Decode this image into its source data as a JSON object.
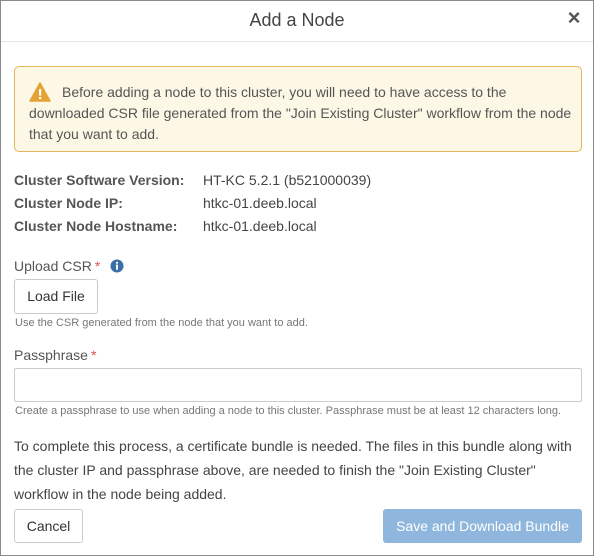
{
  "dialog": {
    "title": "Add a Node",
    "close_symbol": "×"
  },
  "alert": {
    "icon": "warning-triangle-icon",
    "text": "Before adding a node to this cluster, you will need to have access to the downloaded CSR file generated from the \"Join Existing Cluster\" workflow from the node that you want to add."
  },
  "cluster_info": [
    {
      "label": "Cluster Software Version:",
      "value": "HT-KC 5.2.1 (b521000039)"
    },
    {
      "label": "Cluster Node IP:",
      "value": "htkc-01.deeb.local"
    },
    {
      "label": "Cluster Node Hostname:",
      "value": "htkc-01.deeb.local"
    }
  ],
  "upload_csr": {
    "label": "Upload CSR",
    "required_marker": "*",
    "info_icon": "info-circle-icon",
    "button_label": "Load File",
    "help": "Use the CSR generated from the node that you want to add."
  },
  "passphrase": {
    "label": "Passphrase",
    "required_marker": "*",
    "value": "",
    "help": "Create a passphrase to use when adding a node to this cluster. Passphrase must be at least 12 characters long."
  },
  "bundle_note": "To complete this process, a certificate bundle is needed. The files in this bundle along with the cluster IP and passphrase above, are needed to finish the \"Join Existing Cluster\" workflow in the node being added.",
  "footer": {
    "cancel_label": "Cancel",
    "save_label": "Save and Download Bundle"
  },
  "colors": {
    "alert_bg": "#fcf8e5",
    "alert_border": "#e5b75d",
    "warning_icon": "#e5a335",
    "required": "#d9534f",
    "primary_disabled": "#8fb6dc",
    "info_icon": "#3a6fa5"
  }
}
